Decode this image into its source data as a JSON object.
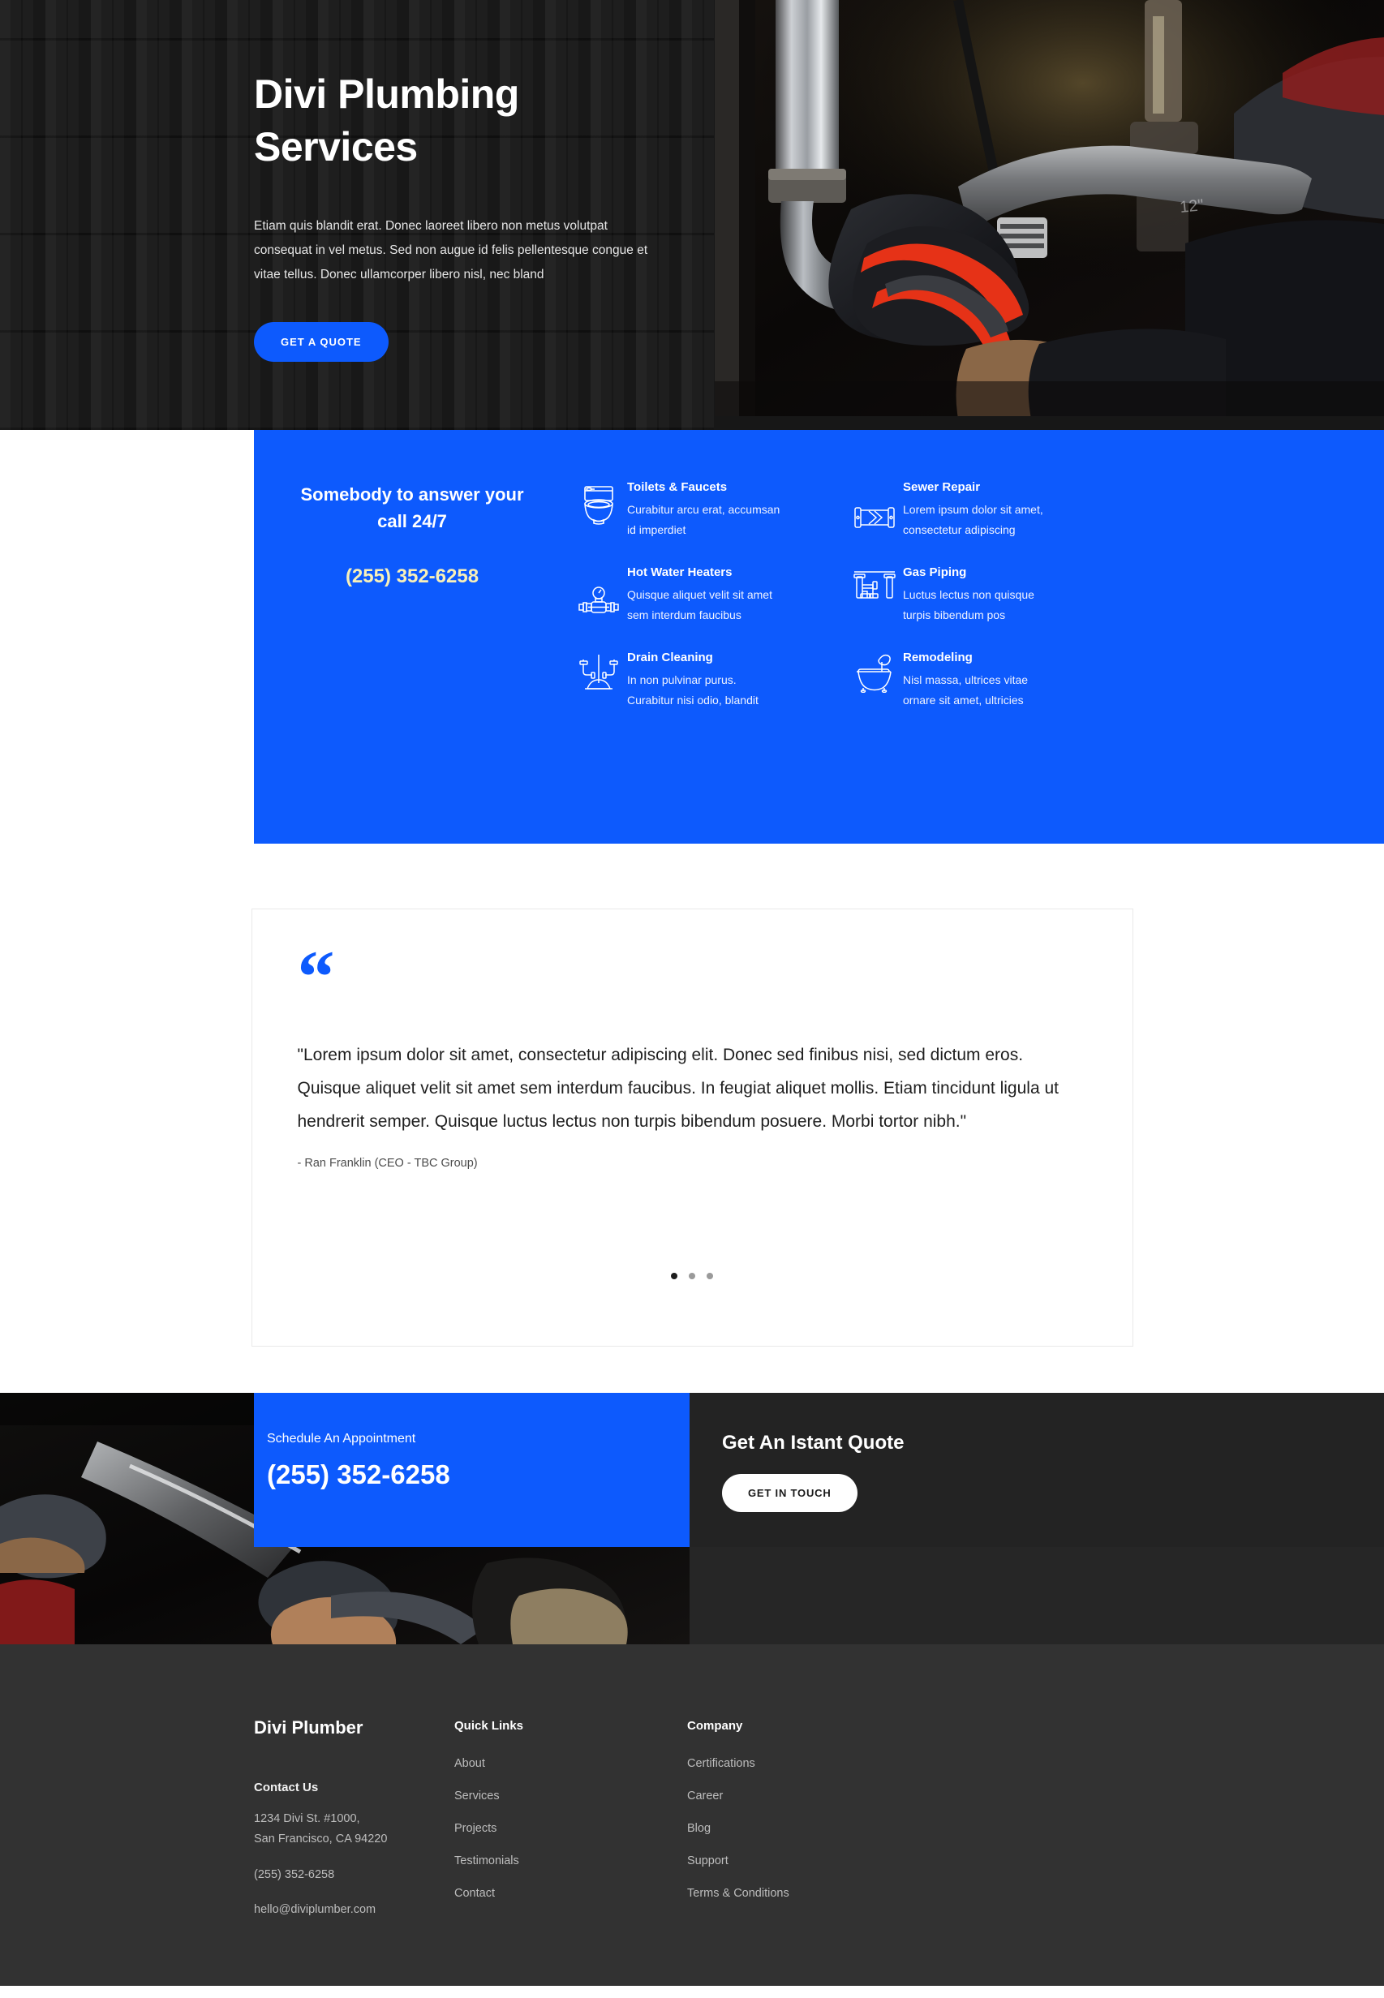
{
  "hero": {
    "title": "Divi Plumbing Services",
    "paragraph": "Etiam quis blandit erat. Donec laoreet libero non metus volutpat consequat in vel metus. Sed non augue id felis pellentesque congue et vitae tellus. Donec ullamcorper libero nisl, nec bland",
    "cta_label": "GET A QUOTE",
    "accent_color": "#0d5afd",
    "photo_alt": "plumber-hand-with-wrench-on-chrome-pipe"
  },
  "services": {
    "callout_title": "Somebody to answer your call 24/7",
    "callout_phone": "(255) 352-6258",
    "phone_color": "#f8f0b9",
    "background_color": "#0d5afd",
    "column_left": [
      {
        "icon": "toilet-icon",
        "name": "Toilets & Faucets",
        "desc": "Curabitur arcu erat, accumsan id imperdiet"
      },
      {
        "icon": "water-heater-icon",
        "name": "Hot Water Heaters",
        "desc": "Quisque aliquet velit sit amet sem interdum faucibus"
      },
      {
        "icon": "plunger-drain-icon",
        "name": "Drain Cleaning",
        "desc": "In non pulvinar purus. Curabitur nisi odio, blandit"
      }
    ],
    "column_right": [
      {
        "icon": "sewer-pipe-icon",
        "name": "Sewer Repair",
        "desc": "Lorem ipsum dolor sit amet, consectetur adipiscing"
      },
      {
        "icon": "gas-piping-icon",
        "name": "Gas Piping",
        "desc": "Luctus lectus non quisque turpis bibendum pos"
      },
      {
        "icon": "bathtub-icon",
        "name": "Remodeling",
        "desc": "Nisl massa, ultrices vitae ornare sit amet, ultricies"
      }
    ]
  },
  "testimonial": {
    "quote_glyph": "“",
    "quote": "\"Lorem ipsum dolor sit amet, consectetur adipiscing elit. Donec sed finibus nisi, sed dictum eros. Quisque aliquet velit sit amet sem interdum faucibus. In feugiat aliquet mollis. Etiam tincidunt ligula ut hendrerit semper. Quisque luctus lectus non turpis bibendum posuere. Morbi tortor nibh.\"",
    "author": "- Ran Franklin (CEO - TBC Group)",
    "slide_count": 3,
    "active_slide": 1
  },
  "cta": {
    "schedule_label": "Schedule An Appointment",
    "schedule_phone": "(255) 352-6258",
    "quote_title": "Get An Istant Quote",
    "quote_button": "GET IN TOUCH",
    "photo_alt": "plumber-hands-with-wrench-closeup"
  },
  "footer": {
    "brand": "Divi Plumber",
    "contact_heading": "Contact Us",
    "address_line1": "1234 Divi St. #1000,",
    "address_line2": "San Francisco, CA 94220",
    "phone": "(255) 352-6258",
    "email": "hello@diviplumber.com",
    "quick_links": {
      "title": "Quick Links",
      "items": [
        "About",
        "Services",
        "Projects",
        "Testimonials",
        "Contact"
      ]
    },
    "company": {
      "title": "Company",
      "items": [
        "Certifications",
        "Career",
        "Blog",
        "Support",
        "Terms & Conditions"
      ]
    }
  }
}
